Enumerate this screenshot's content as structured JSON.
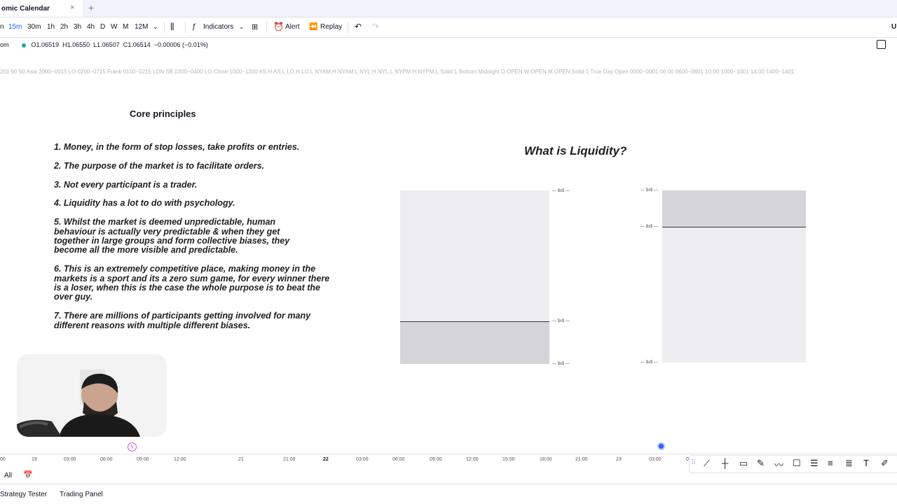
{
  "tab": {
    "title": "omic Calendar",
    "close": "×",
    "add": "+"
  },
  "toolbar": {
    "timeframes": [
      "n",
      "15m",
      "30m",
      "1h",
      "2h",
      "3h",
      "4h",
      "D",
      "W",
      "M",
      "12M"
    ],
    "active_timeframe": "15m",
    "indicators_label": "Indicators",
    "alert_label": "Alert",
    "replay_label": "Replay",
    "right_label": "U"
  },
  "ohlc": {
    "symbol_fragment": "om",
    "open": "O1.06519",
    "high": "H1.06550",
    "low": "L1.06507",
    "close": "C1.06514",
    "change": "−0.00006 (−0.01%)"
  },
  "indicator_strip": "201 90 50 Asia 2000−0015 LO 0200−0715 Frank 0100−0215 LDN SB 0300−0400 LO Close 1000−1200 AS.H AS.L LO.H LO.L NYAM.H NYAM.L NYL.H NYL.L NYPM.H NYPM.L Solid 1 Bottom Midnight D.OPEN W.OPEN M.OPEN Solid 1 True Day Open 0000−0001 06:00 0600−0601 10:00 1000−1001 14:00 1400−1401",
  "slide": {
    "core_title": "Core principles",
    "principles": [
      "1. Money, in the form of stop losses, take profits or entries.",
      "2. The purpose of the market is to facilitate orders.",
      "3. Not every participant is a trader.",
      "4. Liquidity has a lot to do with psychology.",
      "5. Whilst the market is deemed unpredictable, human behaviour is actually very predictable & when they get together in large groups and form collective biases, they become all the more visible and predictable.",
      "6. This is an extremely competitive place, making money in the markets is a sport and its a zero sum game, for every winner there is a loser, when this is the case the whole purpose is to beat the over guy.",
      "7. There are millions of participants getting involved for many different reasons with multiple different biases."
    ],
    "liquidity_title": "What is Liquidity?",
    "price_label": "$x$"
  },
  "axis": {
    "ticks": [
      "00",
      "19",
      "03:00",
      "06:00",
      "09:00",
      "12:00",
      "21",
      "21:00",
      "22",
      "03:00",
      "06:00",
      "09:00",
      "12:00",
      "15:00",
      "18:00",
      "21:00",
      "23",
      "03:00",
      "0"
    ],
    "bold_tick": "22"
  },
  "bottom": {
    "all_label": "All",
    "strategy_tester": "Strategy Tester",
    "trading_panel": "Trading Panel"
  }
}
